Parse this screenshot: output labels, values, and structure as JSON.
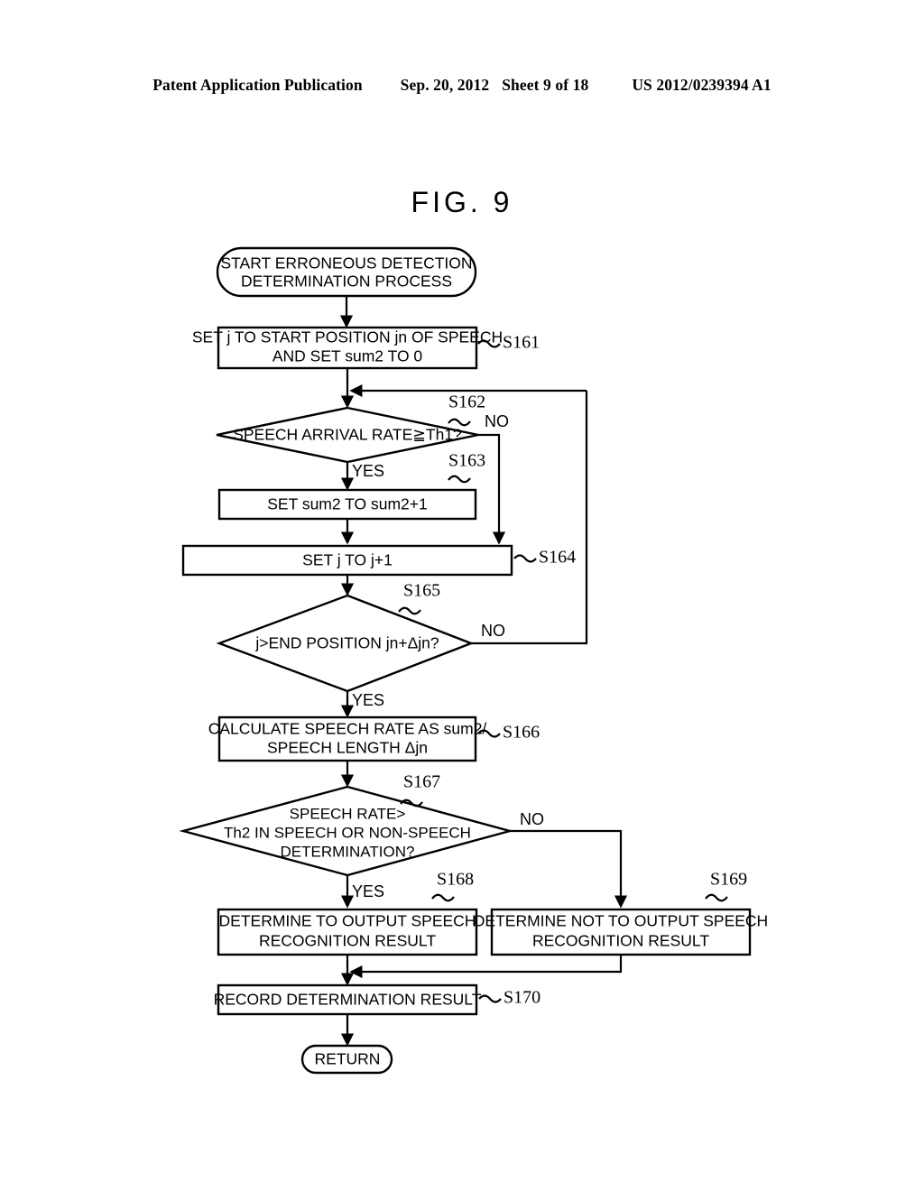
{
  "header": {
    "publication": "Patent Application Publication",
    "date": "Sep. 20, 2012",
    "sheet": "Sheet 9 of 18",
    "patent_number": "US 2012/0239394 A1"
  },
  "figure": {
    "title": "FIG. 9"
  },
  "flowchart": {
    "start": {
      "ref": "",
      "line1": "START ERRONEOUS DETECTION",
      "line2": "DETERMINATION PROCESS"
    },
    "s161": {
      "ref": "S161",
      "line1": "SET j TO START POSITION jn OF SPEECH",
      "line2": "AND SET sum2 TO 0"
    },
    "s162": {
      "ref": "S162",
      "line1": "SPEECH ARRIVAL RATE≧Th1?",
      "yes": "YES",
      "no": "NO"
    },
    "s163": {
      "ref": "S163",
      "line1": "SET sum2 TO sum2+1"
    },
    "s164": {
      "ref": "S164",
      "line1": "SET j TO j+1"
    },
    "s165": {
      "ref": "S165",
      "line1": "j>END POSITION jn+Δjn?",
      "yes": "YES",
      "no": "NO"
    },
    "s166": {
      "ref": "S166",
      "line1": "CALCULATE SPEECH RATE AS sum2/",
      "line2": "SPEECH LENGTH Δjn"
    },
    "s167": {
      "ref": "S167",
      "line1": "SPEECH RATE>",
      "line2": "Th2 IN SPEECH OR NON-SPEECH",
      "line3": "DETERMINATION?",
      "yes": "YES",
      "no": "NO"
    },
    "s168": {
      "ref": "S168",
      "line1": "DETERMINE TO OUTPUT SPEECH",
      "line2": "RECOGNITION RESULT"
    },
    "s169": {
      "ref": "S169",
      "line1": "DETERMINE NOT TO OUTPUT SPEECH",
      "line2": "RECOGNITION RESULT"
    },
    "s170": {
      "ref": "S170",
      "line1": "RECORD DETERMINATION RESULT"
    },
    "end": {
      "line1": "RETURN"
    }
  },
  "colors": {
    "ink": "#000000",
    "paper": "#ffffff"
  }
}
